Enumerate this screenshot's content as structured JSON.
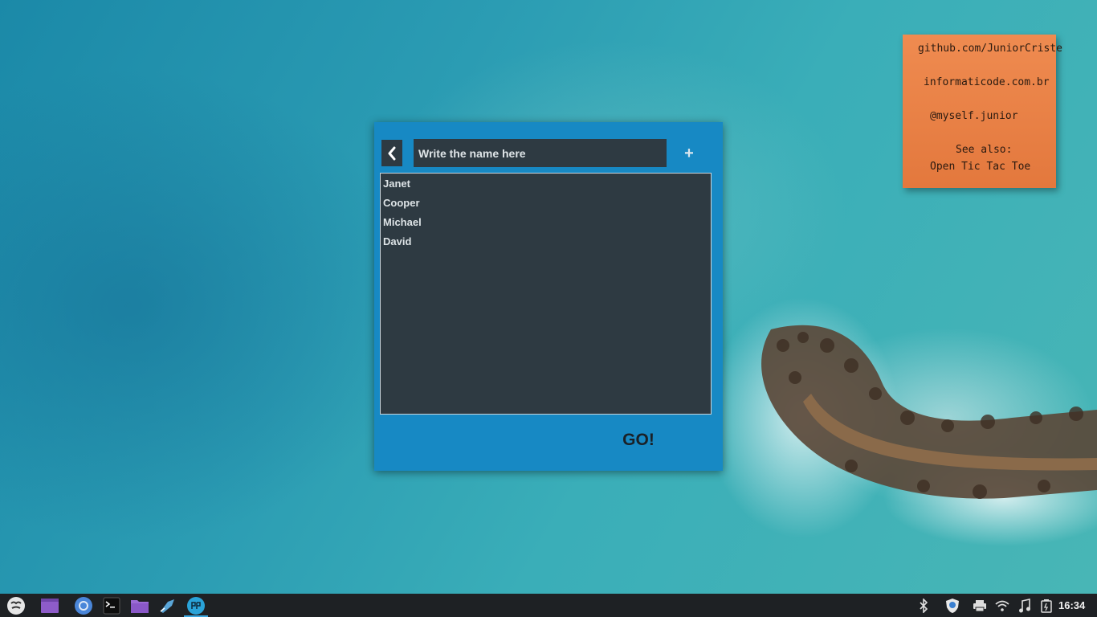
{
  "sticky_note": {
    "lines": [
      "github.com/JuniorCriste",
      "informaticode.com.br",
      "@myself.junior",
      "See also:",
      "Open Tic Tac Toe"
    ]
  },
  "app": {
    "input_placeholder": "Write the name here",
    "add_label": "+",
    "names": [
      "Janet",
      "Cooper",
      "Michael",
      "David"
    ],
    "go_label": "GO!"
  },
  "taskbar": {
    "apps": [
      "menu-icon",
      "window-icon",
      "browser-icon",
      "terminal-icon",
      "folder-icon",
      "fish-icon",
      "app-logo-icon"
    ],
    "active_app": "app-logo-icon",
    "tray": [
      "bluetooth-icon",
      "shield-icon",
      "printer-icon",
      "wifi-icon",
      "music-icon",
      "battery-icon"
    ],
    "clock": "16:34"
  },
  "colors": {
    "window_bg": "#1789c4",
    "panel_bg": "#2e3a42",
    "sticky_bg": "#ea8245",
    "taskbar_bg": "#1e2124"
  }
}
